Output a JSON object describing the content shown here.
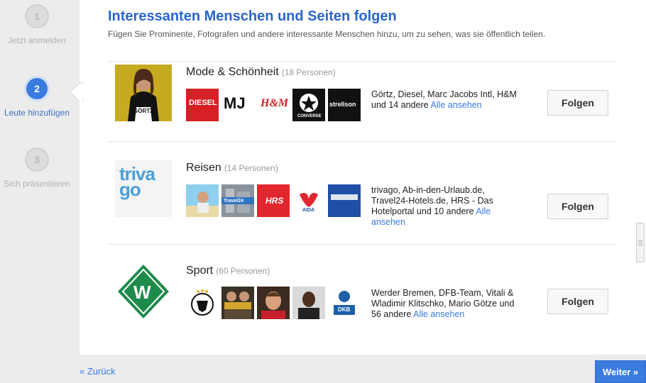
{
  "stepper": {
    "steps": [
      {
        "number": "1",
        "label": "Jetzt anmelden"
      },
      {
        "number": "2",
        "label": "Leute hinzufügen"
      },
      {
        "number": "3",
        "label": "Sich präsentieren"
      }
    ]
  },
  "header": {
    "title": "Interessanten Menschen und Seiten folgen",
    "subtitle": "Fügen Sie Prominente, Fotografen und andere interessante Menschen hinzu, um zu sehen, was sie öffentlich teilen."
  },
  "categories": [
    {
      "name": "Mode & Schönheit",
      "count": "(18 Personen)",
      "cover_label": "GÖRTZ",
      "thumbs": [
        "DIESEL",
        "MJ",
        "H&M",
        "CONVERSE",
        "strellson"
      ],
      "desc_text": "Görtz, Diesel, Marc Jacobs Intl, H&M und 14 andere",
      "see_all": "Alle ansehen",
      "follow_label": "Folgen"
    },
    {
      "name": "Reisen",
      "count": "(14 Personen)",
      "cover_label": "trivago",
      "thumbs": [
        "Travel24",
        "HRS",
        "AIDA"
      ],
      "desc_text": "trivago, Ab-in-den-Urlaub.de, Travel24-Hotels.de, HRS - Das Hotelportal und 10 andere",
      "see_all": "Alle ansehen",
      "follow_label": "Folgen"
    },
    {
      "name": "Sport",
      "count": "(60 Personen)",
      "cover_label": "W",
      "thumbs": [
        "DKB"
      ],
      "desc_text": "Werder Bremen, DFB-Team, Vitali & Wladimir Klitschko, Mario Götze und 56 andere",
      "see_all": "Alle ansehen",
      "follow_label": "Folgen"
    }
  ],
  "footer": {
    "back_label": "« Zurück",
    "next_label": "Weiter »"
  },
  "colors": {
    "accent": "#3a7be0",
    "title": "#2a66c9",
    "diesel_red": "#d71f26",
    "hrs_red": "#e2262d",
    "werder_green": "#1e8b4a"
  }
}
